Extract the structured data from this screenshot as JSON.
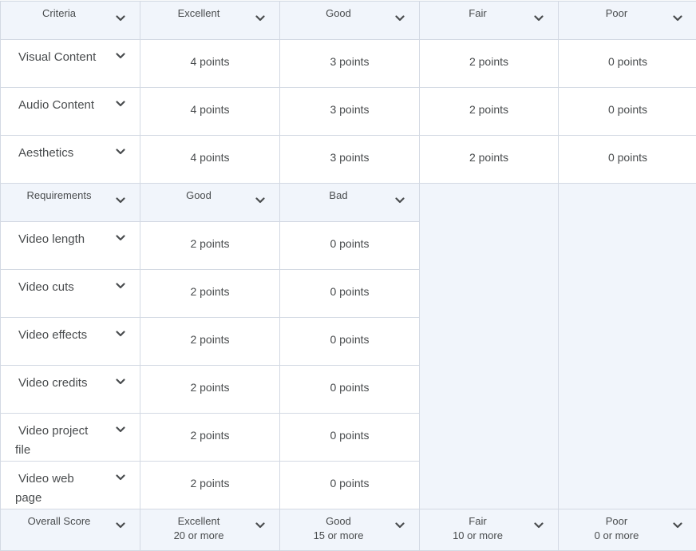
{
  "criteria_header": {
    "title": "Criteria",
    "levels": [
      "Excellent",
      "Good",
      "Fair",
      "Poor"
    ]
  },
  "criteria_rows": [
    {
      "name": "Visual Content",
      "points": [
        "4 points",
        "3 points",
        "2 points",
        "0 points"
      ]
    },
    {
      "name": "Audio Content",
      "points": [
        "4 points",
        "3 points",
        "2 points",
        "0 points"
      ]
    },
    {
      "name": "Aesthetics",
      "points": [
        "4 points",
        "3 points",
        "2 points",
        "0 points"
      ]
    }
  ],
  "requirements_header": {
    "title": "Requirements",
    "levels": [
      "Good",
      "Bad"
    ]
  },
  "requirements_rows": [
    {
      "name": "Video length",
      "points": [
        "2 points",
        "0 points"
      ]
    },
    {
      "name": "Video cuts",
      "points": [
        "2 points",
        "0 points"
      ]
    },
    {
      "name": "Video effects",
      "points": [
        "2 points",
        "0 points"
      ]
    },
    {
      "name": "Video credits",
      "points": [
        "2 points",
        "0 points"
      ]
    },
    {
      "name_line1": "Video project",
      "name_line2": "file",
      "points": [
        "2 points",
        "0 points"
      ]
    },
    {
      "name_line1": "Video web",
      "name_line2": "page",
      "points": [
        "2 points",
        "0 points"
      ]
    }
  ],
  "overall_score": {
    "title": "Overall Score",
    "levels": [
      {
        "label": "Excellent",
        "threshold": "20 or more"
      },
      {
        "label": "Good",
        "threshold": "15 or more"
      },
      {
        "label": "Fair",
        "threshold": "10 or more"
      },
      {
        "label": "Poor",
        "threshold": "0 or more"
      }
    ]
  },
  "icons": {
    "expand": "chevron-down-icon"
  },
  "colors": {
    "header_bg": "#f1f5fb",
    "border": "#d3d9e3",
    "text": "#494c4e",
    "cell_bg": "#ffffff"
  }
}
